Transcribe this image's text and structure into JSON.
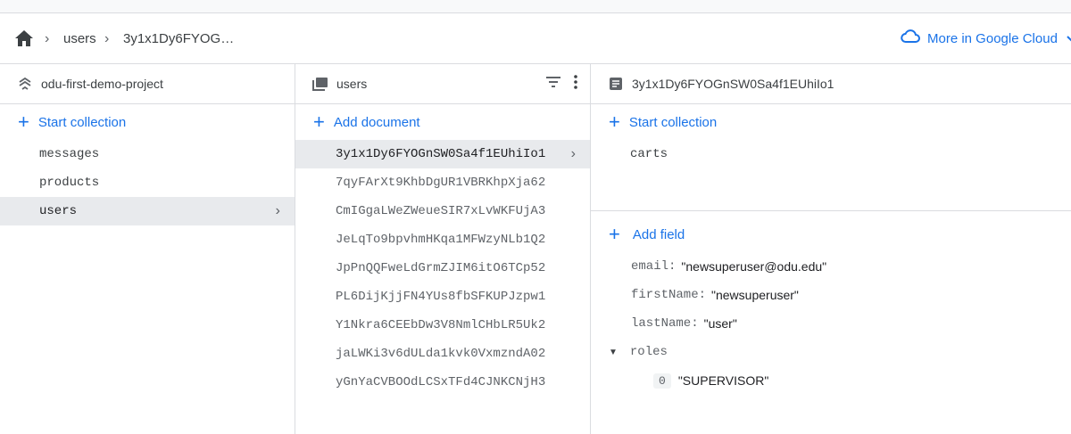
{
  "breadcrumb": {
    "items": [
      "users",
      "3y1x1Dy6FYOG…"
    ],
    "more": "More in Google Cloud"
  },
  "col1": {
    "project": "odu-first-demo-project",
    "action": "Start collection",
    "items": [
      "messages",
      "products",
      "users"
    ]
  },
  "col2": {
    "title": "users",
    "action": "Add document",
    "items": [
      "3y1x1Dy6FYOGnSW0Sa4f1EUhiIo1",
      "7qyFArXt9KhbDgUR1VBRKhpXja62",
      "CmIGgaLWeZWeueSIR7xLvWKFUjA3",
      "JeLqTo9bpvhmHKqa1MFWzyNLb1Q2",
      "JpPnQQFweLdGrmZJIM6itO6TCp52",
      "PL6DijKjjFN4YUs8fbSFKUPJzpw1",
      "Y1Nkra6CEEbDw3V8NmlCHbLR5Uk2",
      "jaLWKi3v6dULda1kvk0VxmzndA02",
      "yGnYaCVBOOdLCSxTFd4CJNKCNjH3"
    ]
  },
  "col3": {
    "title": "3y1x1Dy6FYOGnSW0Sa4f1EUhiIo1",
    "action": "Start collection",
    "subcollections": [
      "carts"
    ],
    "add_field": "Add field",
    "fields": [
      {
        "key": "email:",
        "value": "\"newsuperuser@odu.edu\""
      },
      {
        "key": "firstName:",
        "value": "\"newsuperuser\""
      },
      {
        "key": "lastName:",
        "value": "\"user\""
      }
    ],
    "roles_key": "roles",
    "roles": [
      {
        "index": "0",
        "value": "\"SUPERVISOR\""
      }
    ]
  },
  "colors": {
    "accent": "#1a73e8",
    "selected_bg": "#e8eaed",
    "border": "#dadce0"
  }
}
